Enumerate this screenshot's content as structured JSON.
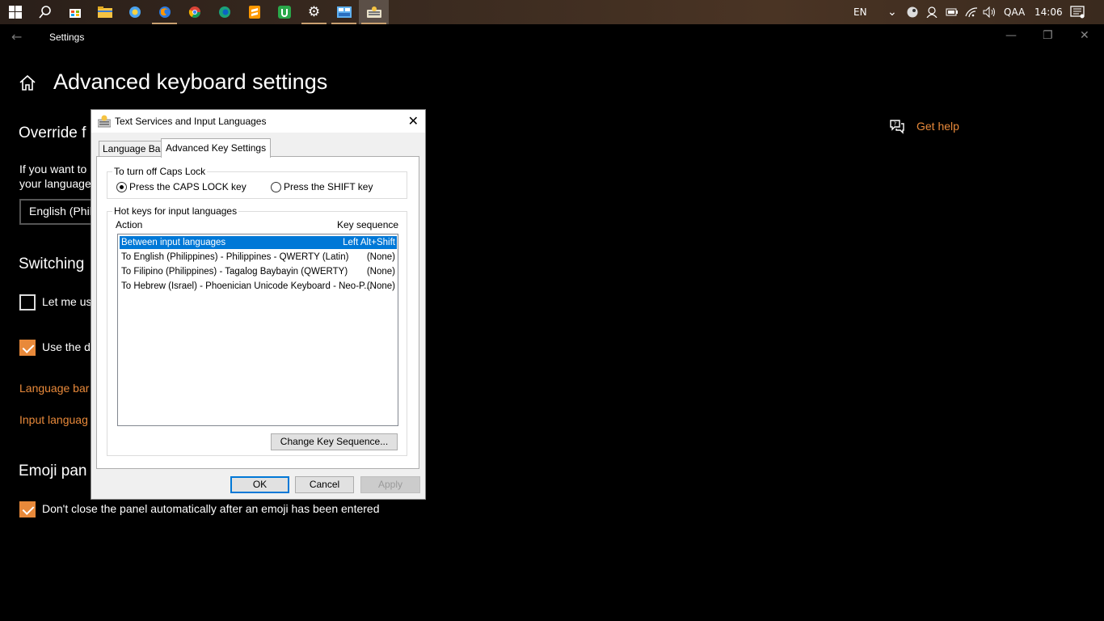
{
  "taskbar": {
    "language": "EN",
    "user": "QAA",
    "time": "14:06"
  },
  "settings": {
    "window_title": "Settings",
    "page_title": "Advanced keyboard settings",
    "override_heading": "Override f",
    "override_text_line1": "If you want to",
    "override_text_line2": "your language",
    "override_combo_value": "English (Phil",
    "switching_heading": "Switching",
    "let_me_use_label": "Let me us",
    "let_me_use_checked": false,
    "use_desktop_label": "Use the d",
    "use_desktop_checked": true,
    "language_bar_link": "Language bar",
    "input_language_link": "Input languag",
    "emoji_heading": "Emoji pan",
    "emoji_checkbox_label": "Don't close the panel automatically after an emoji has been entered",
    "emoji_checkbox_checked": true,
    "get_help_label": "Get help",
    "accent_color": "#e8893a"
  },
  "dialog": {
    "title": "Text Services and Input Languages",
    "tabs": [
      {
        "label": "Language Bar",
        "selected": false
      },
      {
        "label": "Advanced Key Settings",
        "selected": true
      }
    ],
    "caps_group_label": "To turn off Caps Lock",
    "caps_options": [
      {
        "label": "Press the CAPS LOCK key",
        "selected": true
      },
      {
        "label": "Press the SHIFT key",
        "selected": false
      }
    ],
    "hotkeys_group_label": "Hot keys for input languages",
    "col_action": "Action",
    "col_key": "Key sequence",
    "rows": [
      {
        "action": "Between input languages",
        "key": "Left Alt+Shift",
        "selected": true
      },
      {
        "action": "To English (Philippines) - Philippines - QWERTY (Latin)",
        "key": "(None)",
        "selected": false
      },
      {
        "action": "To Filipino (Philippines) - Tagalog Baybayin (QWERTY)",
        "key": "(None)",
        "selected": false
      },
      {
        "action": "To Hebrew (Israel) - Phoenician Unicode Keyboard - Neo-P...",
        "key": "(None)",
        "selected": false
      }
    ],
    "change_key_button": "Change Key Sequence...",
    "ok_button": "OK",
    "cancel_button": "Cancel",
    "apply_button": "Apply"
  }
}
